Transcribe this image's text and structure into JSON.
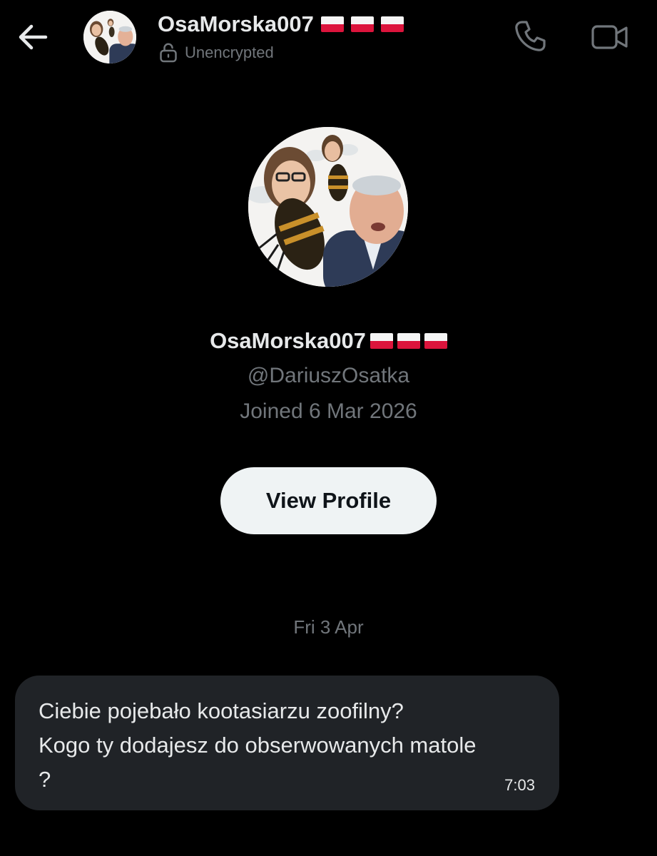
{
  "header": {
    "display_name": "OsaMorska007",
    "status": "Unencrypted",
    "flags": [
      "poland-flag",
      "poland-flag",
      "poland-flag"
    ]
  },
  "profile": {
    "display_name": "OsaMorska007",
    "handle": "@DariuszOsatka",
    "joined": "Joined 6 Mar 2026",
    "view_profile_label": "View Profile"
  },
  "conversation": {
    "date_separator": "Fri 3 Apr",
    "messages": [
      {
        "lines": [
          "Ciebie pojebało kootasiarzu zoofilny?",
          "Kogo ty dodajesz do obserwowanych matole",
          "?"
        ],
        "time": "7:03"
      }
    ]
  },
  "icons": {
    "back": "arrow-left-icon",
    "lock": "lock-open-icon",
    "call": "phone-icon",
    "video": "video-camera-icon"
  },
  "colors": {
    "background": "#000000",
    "primary_text": "#e7e9ea",
    "secondary_text": "#71767b",
    "bubble": "#202327",
    "button_bg": "#eff3f4",
    "flag_red": "#dc143c"
  }
}
